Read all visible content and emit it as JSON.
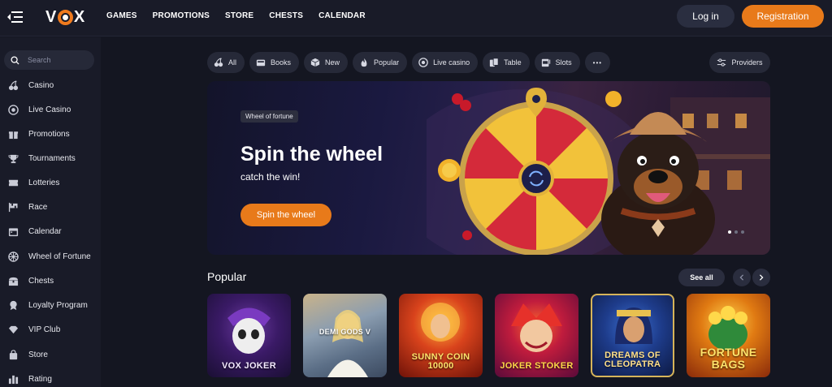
{
  "header": {
    "logo": "VOX",
    "nav": [
      "GAMES",
      "PROMOTIONS",
      "STORE",
      "CHESTS",
      "CALENDAR"
    ],
    "login_label": "Log in",
    "register_label": "Registration"
  },
  "sidebar": {
    "search_placeholder": "Search",
    "items": [
      {
        "label": "Casino",
        "icon": "cherries-icon"
      },
      {
        "label": "Live Casino",
        "icon": "chip-icon"
      },
      {
        "label": "Promotions",
        "icon": "gift-icon"
      },
      {
        "label": "Tournaments",
        "icon": "trophy-icon"
      },
      {
        "label": "Lotteries",
        "icon": "ticket-icon"
      },
      {
        "label": "Race",
        "icon": "flag-icon"
      },
      {
        "label": "Calendar",
        "icon": "calendar-icon"
      },
      {
        "label": "Wheel of Fortune",
        "icon": "wheel-icon"
      },
      {
        "label": "Chests",
        "icon": "chest-icon"
      },
      {
        "label": "Loyalty Program",
        "icon": "medal-icon"
      },
      {
        "label": "VIP Club",
        "icon": "diamond-icon"
      },
      {
        "label": "Store",
        "icon": "bag-icon"
      },
      {
        "label": "Rating",
        "icon": "bars-icon"
      }
    ]
  },
  "filters": {
    "chips": [
      {
        "label": "All",
        "icon": "cherries-icon"
      },
      {
        "label": "Books",
        "icon": "book-icon"
      },
      {
        "label": "New",
        "icon": "cube-icon"
      },
      {
        "label": "Popular",
        "icon": "flame-icon"
      },
      {
        "label": "Live casino",
        "icon": "chip-icon"
      },
      {
        "label": "Table",
        "icon": "cards-icon"
      },
      {
        "label": "Slots",
        "icon": "slot-icon"
      }
    ],
    "more_label": "•••",
    "providers_label": "Providers"
  },
  "banner": {
    "tag": "Wheel of fortune",
    "title": "Spin the wheel",
    "subtitle": "catch the win!",
    "button": "Spin the wheel"
  },
  "popular": {
    "title": "Popular",
    "see_all": "See all",
    "games": [
      {
        "title": "VOX JOKER"
      },
      {
        "title": "DEMI GODS V"
      },
      {
        "title": "SUNNY COIN 10000"
      },
      {
        "title": "JOKER STOKER"
      },
      {
        "title": "DREAMS OF CLEOPATRA"
      },
      {
        "title": "FORTUNE BAGS"
      }
    ]
  },
  "colors": {
    "accent": "#e87a1a",
    "background": "#141621",
    "panel": "#191b28",
    "chip": "#262938"
  }
}
